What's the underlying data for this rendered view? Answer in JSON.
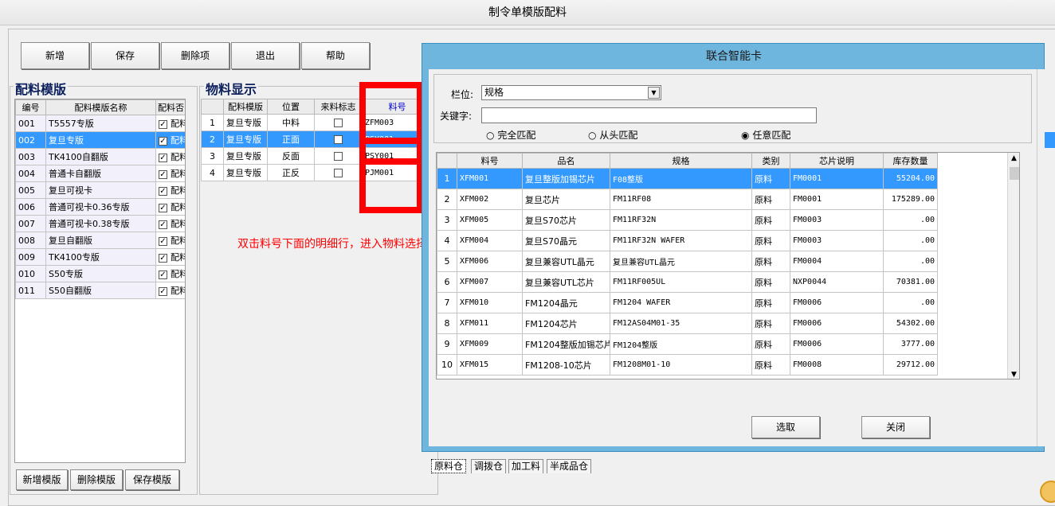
{
  "window": {
    "title": "制令单模版配料"
  },
  "toolbar": {
    "add": "新增",
    "save": "保存",
    "delete_item": "删除项",
    "exit": "退出",
    "help": "帮助"
  },
  "left_panel": {
    "title": "配料模版",
    "columns": [
      "编号",
      "配料模版名称",
      "配料否"
    ],
    "rows": [
      {
        "id": "001",
        "name": "T5557专版",
        "flag": "配料"
      },
      {
        "id": "002",
        "name": "复旦专版",
        "flag": "配料"
      },
      {
        "id": "003",
        "name": "TK4100自翻版",
        "flag": "配料"
      },
      {
        "id": "004",
        "name": "普通卡自翻版",
        "flag": "配料"
      },
      {
        "id": "005",
        "name": "复旦可视卡",
        "flag": "配料"
      },
      {
        "id": "006",
        "name": "普通可视卡0.36专版",
        "flag": "配料"
      },
      {
        "id": "007",
        "name": "普通可视卡0.38专版",
        "flag": "配料"
      },
      {
        "id": "008",
        "name": "复旦自翻版",
        "flag": "配料"
      },
      {
        "id": "009",
        "name": "TK4100专版",
        "flag": "配料"
      },
      {
        "id": "010",
        "name": "S50专版",
        "flag": "配料"
      },
      {
        "id": "011",
        "name": "S50自翻版",
        "flag": "配料"
      }
    ],
    "selected_index": 1,
    "buttons": {
      "add_template": "新增模版",
      "delete_template": "删除模版",
      "save_template": "保存模版"
    }
  },
  "material_panel": {
    "title": "物料显示",
    "columns": [
      "",
      "配料模版",
      "位置",
      "来料标志",
      "料号"
    ],
    "rows": [
      {
        "no": "1",
        "template": "复旦专版",
        "pos": "中料",
        "code": "ZFM003"
      },
      {
        "no": "2",
        "template": "复旦专版",
        "pos": "正面",
        "code": "PSY001"
      },
      {
        "no": "3",
        "template": "复旦专版",
        "pos": "反面",
        "code": "PSY001"
      },
      {
        "no": "4",
        "template": "复旦专版",
        "pos": "正反",
        "code": "PJM001"
      }
    ],
    "selected_index": 1
  },
  "annotation": {
    "text": "双击料号下面的明细行，进入物料选择窗口"
  },
  "dialog": {
    "title": "联合智能卡",
    "field_label": "栏位:",
    "field_value": "规格",
    "keyword_label": "关键字:",
    "keyword_value": "",
    "match_options": [
      "完全匹配",
      "从头匹配",
      "任意匹配"
    ],
    "selected_match": 2,
    "columns": [
      "",
      "料号",
      "品名",
      "规格",
      "类别",
      "芯片说明",
      "库存数量"
    ],
    "rows": [
      {
        "no": "1",
        "code": "XFM001",
        "name": "复旦整版加锡芯片",
        "spec": "F08整版",
        "category": "原料",
        "chip": "FM0001",
        "stock": "55204.00"
      },
      {
        "no": "2",
        "code": "XFM002",
        "name": "复旦芯片",
        "spec": " FM11RF08",
        "category": "原料",
        "chip": "FM0001",
        "stock": "175289.00"
      },
      {
        "no": "3",
        "code": "XFM005",
        "name": "复旦S70芯片",
        "spec": "FM11RF32N",
        "category": "原料",
        "chip": "FM0003",
        "stock": ".00"
      },
      {
        "no": "4",
        "code": "XFM004",
        "name": "复旦S70晶元",
        "spec": "FM11RF32N WAFER",
        "category": "原料",
        "chip": "FM0003",
        "stock": ".00"
      },
      {
        "no": "5",
        "code": "XFM006",
        "name": "复旦兼容UTL晶元",
        "spec": "复旦兼容UTL晶元",
        "category": "原料",
        "chip": "FM0004",
        "stock": ".00"
      },
      {
        "no": "6",
        "code": "XFM007",
        "name": "复旦兼容UTL芯片",
        "spec": "FM11RF005UL",
        "category": "原料",
        "chip": "NXP0044",
        "stock": "70381.00"
      },
      {
        "no": "7",
        "code": "XFM010",
        "name": "FM1204晶元",
        "spec": "FM1204 WAFER",
        "category": "原料",
        "chip": "FM0006",
        "stock": ".00"
      },
      {
        "no": "8",
        "code": "XFM011",
        "name": "FM1204芯片",
        "spec": "FM12AS04M01-35",
        "category": "原料",
        "chip": "FM0006",
        "stock": "54302.00"
      },
      {
        "no": "9",
        "code": "XFM009",
        "name": "FM1204整版加锡芯片",
        "spec": "FM1204整版",
        "category": "原料",
        "chip": "FM0006",
        "stock": "3777.00"
      },
      {
        "no": "10",
        "code": "XFM015",
        "name": "FM1208-10芯片",
        "spec": "FM1208M01-10",
        "category": "原料",
        "chip": "FM0008",
        "stock": "29712.00"
      }
    ],
    "selected_index": 0,
    "tabs": [
      "原料仓",
      "调拨仓",
      "加工料",
      "半成品仓"
    ],
    "active_tab": 0,
    "select_button": "选取",
    "close_button": "关闭"
  }
}
